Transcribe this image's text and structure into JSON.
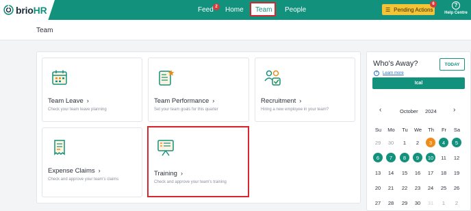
{
  "brand": {
    "name_prefix": "brio",
    "name_suffix": "HR"
  },
  "nav": {
    "feed": {
      "label": "Feed",
      "badge": "2"
    },
    "home": {
      "label": "Home"
    },
    "team": {
      "label": "Team"
    },
    "people": {
      "label": "People"
    }
  },
  "pending": {
    "label": "Pending Actions",
    "badge": "6"
  },
  "help": {
    "label": "Help Centre"
  },
  "page": {
    "title": "Team"
  },
  "cards": [
    {
      "title": "Team Leave",
      "desc": "Check your team leave planning",
      "icon": "calendar-icon"
    },
    {
      "title": "Team Performance",
      "desc": "Set your team goals for this quarter",
      "icon": "performance-chart-icon"
    },
    {
      "title": "Recruitment",
      "desc": "Hiring a new employee in your team?",
      "icon": "people-check-icon"
    },
    {
      "title": "Expense Claims",
      "desc": "Check and approve your team's claims",
      "icon": "receipt-icon"
    },
    {
      "title": "Training",
      "desc": "Check and approve your team's training",
      "icon": "presentation-board-icon"
    }
  ],
  "away": {
    "title": "Who's Away?",
    "today_label": "TODAY",
    "learn_more": "Learn more",
    "ical_label": "Ical"
  },
  "calendar": {
    "month": "October",
    "year": "2024",
    "weekdays": [
      "Su",
      "Mo",
      "Tu",
      "We",
      "Th",
      "Fr",
      "Sa"
    ],
    "weeks": [
      [
        "29",
        "30",
        "1",
        "2",
        "3",
        "4",
        "5"
      ],
      [
        "6",
        "7",
        "8",
        "9",
        "10",
        "11",
        "12"
      ],
      [
        "13",
        "14",
        "15",
        "16",
        "17",
        "18",
        "19"
      ],
      [
        "20",
        "21",
        "22",
        "23",
        "24",
        "25",
        "26"
      ],
      [
        "27",
        "28",
        "29",
        "30",
        "31",
        "1",
        "2"
      ]
    ],
    "today": "3",
    "away_days": [
      "4",
      "5",
      "6",
      "7",
      "8",
      "9",
      "10"
    ]
  },
  "colors": {
    "brand": "#12917d",
    "highlight": "#d7262d",
    "pending": "#f5c336",
    "today": "#f28a17"
  }
}
